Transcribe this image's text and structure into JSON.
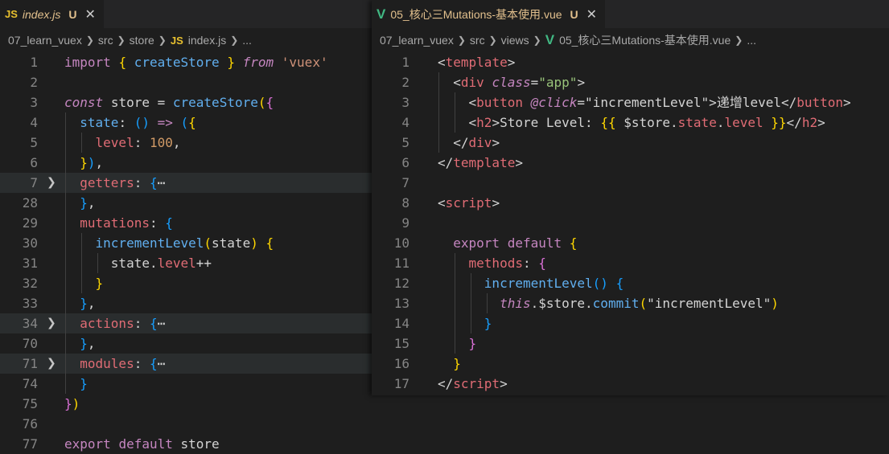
{
  "left_editor": {
    "tab": {
      "icon": "JS",
      "filename": "index.js",
      "status": "U",
      "close": "✕"
    },
    "breadcrumb": [
      "07_learn_vuex",
      "src",
      "store",
      "index.js",
      "..."
    ],
    "breadcrumb_icon": "JS",
    "lines": [
      {
        "n": "1"
      },
      {
        "n": "2"
      },
      {
        "n": "3"
      },
      {
        "n": "4"
      },
      {
        "n": "5"
      },
      {
        "n": "6"
      },
      {
        "n": "7"
      },
      {
        "n": "28"
      },
      {
        "n": "29"
      },
      {
        "n": "30"
      },
      {
        "n": "31"
      },
      {
        "n": "32"
      },
      {
        "n": "33"
      },
      {
        "n": "34"
      },
      {
        "n": "70"
      },
      {
        "n": "71"
      },
      {
        "n": "74"
      },
      {
        "n": "75"
      },
      {
        "n": "76"
      },
      {
        "n": "77"
      }
    ],
    "code": {
      "import": "import",
      "createStore_import": "createStore",
      "from": "from",
      "vuex": "'vuex'",
      "const": "const",
      "store_var": "store",
      "createStore_call": "createStore",
      "state": "state",
      "level": "level",
      "level_value": "100",
      "getters": "getters",
      "mutations": "mutations",
      "incrementLevel": "incrementLevel",
      "state_param": "state",
      "state_obj": "state",
      "level_prop": "level",
      "actions": "actions",
      "modules": "modules",
      "export": "export",
      "default": "default",
      "store_export": "store",
      "ellipsis": "⋯"
    }
  },
  "right_editor": {
    "tab": {
      "icon": "V",
      "filename": "05_核心三Mutations-基本使用.vue",
      "status": "U",
      "close": "✕"
    },
    "breadcrumb": [
      "07_learn_vuex",
      "src",
      "views",
      "05_核心三Mutations-基本使用.vue",
      "..."
    ],
    "breadcrumb_icon": "V",
    "lines": [
      {
        "n": "1"
      },
      {
        "n": "2"
      },
      {
        "n": "3"
      },
      {
        "n": "4"
      },
      {
        "n": "5"
      },
      {
        "n": "6"
      },
      {
        "n": "7"
      },
      {
        "n": "8"
      },
      {
        "n": "9"
      },
      {
        "n": "10"
      },
      {
        "n": "11"
      },
      {
        "n": "12"
      },
      {
        "n": "13"
      },
      {
        "n": "14"
      },
      {
        "n": "15"
      },
      {
        "n": "16"
      },
      {
        "n": "17"
      }
    ],
    "code": {
      "template": "template",
      "div": "div",
      "class_attr": "class",
      "app": "\"app\"",
      "button": "button",
      "click_attr": "@click",
      "click_value": "\"incrementLevel\"",
      "button_text": "递增level",
      "h2": "h2",
      "h2_text": "Store Level: ",
      "store_expr": "$store",
      "state": "state",
      "level": "level",
      "script": "script",
      "export": "export",
      "default": "default",
      "methods": "methods",
      "incrementLevel": "incrementLevel",
      "this": "this",
      "store": "$store",
      "commit": "commit",
      "commit_arg": "\"incrementLevel\""
    }
  }
}
